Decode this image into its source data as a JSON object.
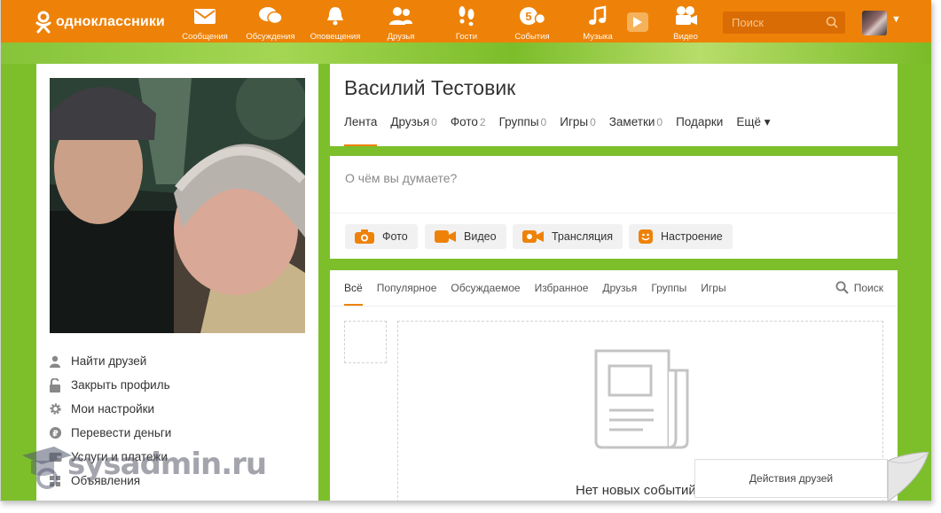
{
  "brand": {
    "name": "одноклассники"
  },
  "topnav": {
    "items": [
      {
        "label": "Сообщения",
        "icon": "envelope-icon"
      },
      {
        "label": "Обсуждения",
        "icon": "chat-bubbles-icon"
      },
      {
        "label": "Оповещения",
        "icon": "bell-icon"
      },
      {
        "label": "Друзья",
        "icon": "friends-icon"
      },
      {
        "label": "Гости",
        "icon": "footprints-icon"
      },
      {
        "label": "События",
        "icon": "events-icon",
        "badge": "5"
      },
      {
        "label": "Музыка",
        "icon": "music-note-icon"
      },
      {
        "label": "Видео",
        "icon": "video-camera-icon"
      }
    ],
    "search_placeholder": "Поиск"
  },
  "left_menu": [
    {
      "label": "Найти друзей",
      "icon": "person-icon"
    },
    {
      "label": "Закрыть профиль",
      "icon": "padlock-icon"
    },
    {
      "label": "Мои настройки",
      "icon": "gear-icon"
    },
    {
      "label": "Перевести деньги",
      "icon": "money-icon"
    },
    {
      "label": "Услуги и платежи",
      "icon": "wallet-icon"
    },
    {
      "label": "Объявления",
      "icon": "ads-icon"
    }
  ],
  "profile": {
    "name": "Василий Тестовик",
    "tabs": [
      {
        "label": "Лента",
        "count": ""
      },
      {
        "label": "Друзья",
        "count": "0"
      },
      {
        "label": "Фото",
        "count": "2"
      },
      {
        "label": "Группы",
        "count": "0"
      },
      {
        "label": "Игры",
        "count": "0"
      },
      {
        "label": "Заметки",
        "count": "0"
      },
      {
        "label": "Подарки",
        "count": ""
      },
      {
        "label": "Ещё ▾",
        "count": ""
      }
    ]
  },
  "post": {
    "placeholder": "О чём вы думаете?",
    "buttons": [
      {
        "label": "Фото",
        "icon": "camera-icon"
      },
      {
        "label": "Видео",
        "icon": "video-icon"
      },
      {
        "label": "Трансляция",
        "icon": "broadcast-icon"
      },
      {
        "label": "Настроение",
        "icon": "smiley-icon"
      }
    ]
  },
  "feed": {
    "tabs": [
      "Всё",
      "Популярное",
      "Обсуждаемое",
      "Избранное",
      "Друзья",
      "Группы",
      "Игры"
    ],
    "search_label": "Поиск",
    "empty_text": "Нет новых событий"
  },
  "friends_actions": {
    "label": "Действия друзей"
  },
  "watermark": {
    "text": "sysadmin.ru"
  },
  "colors": {
    "accent": "#ee8208",
    "background_green": "#7cbf2b"
  }
}
